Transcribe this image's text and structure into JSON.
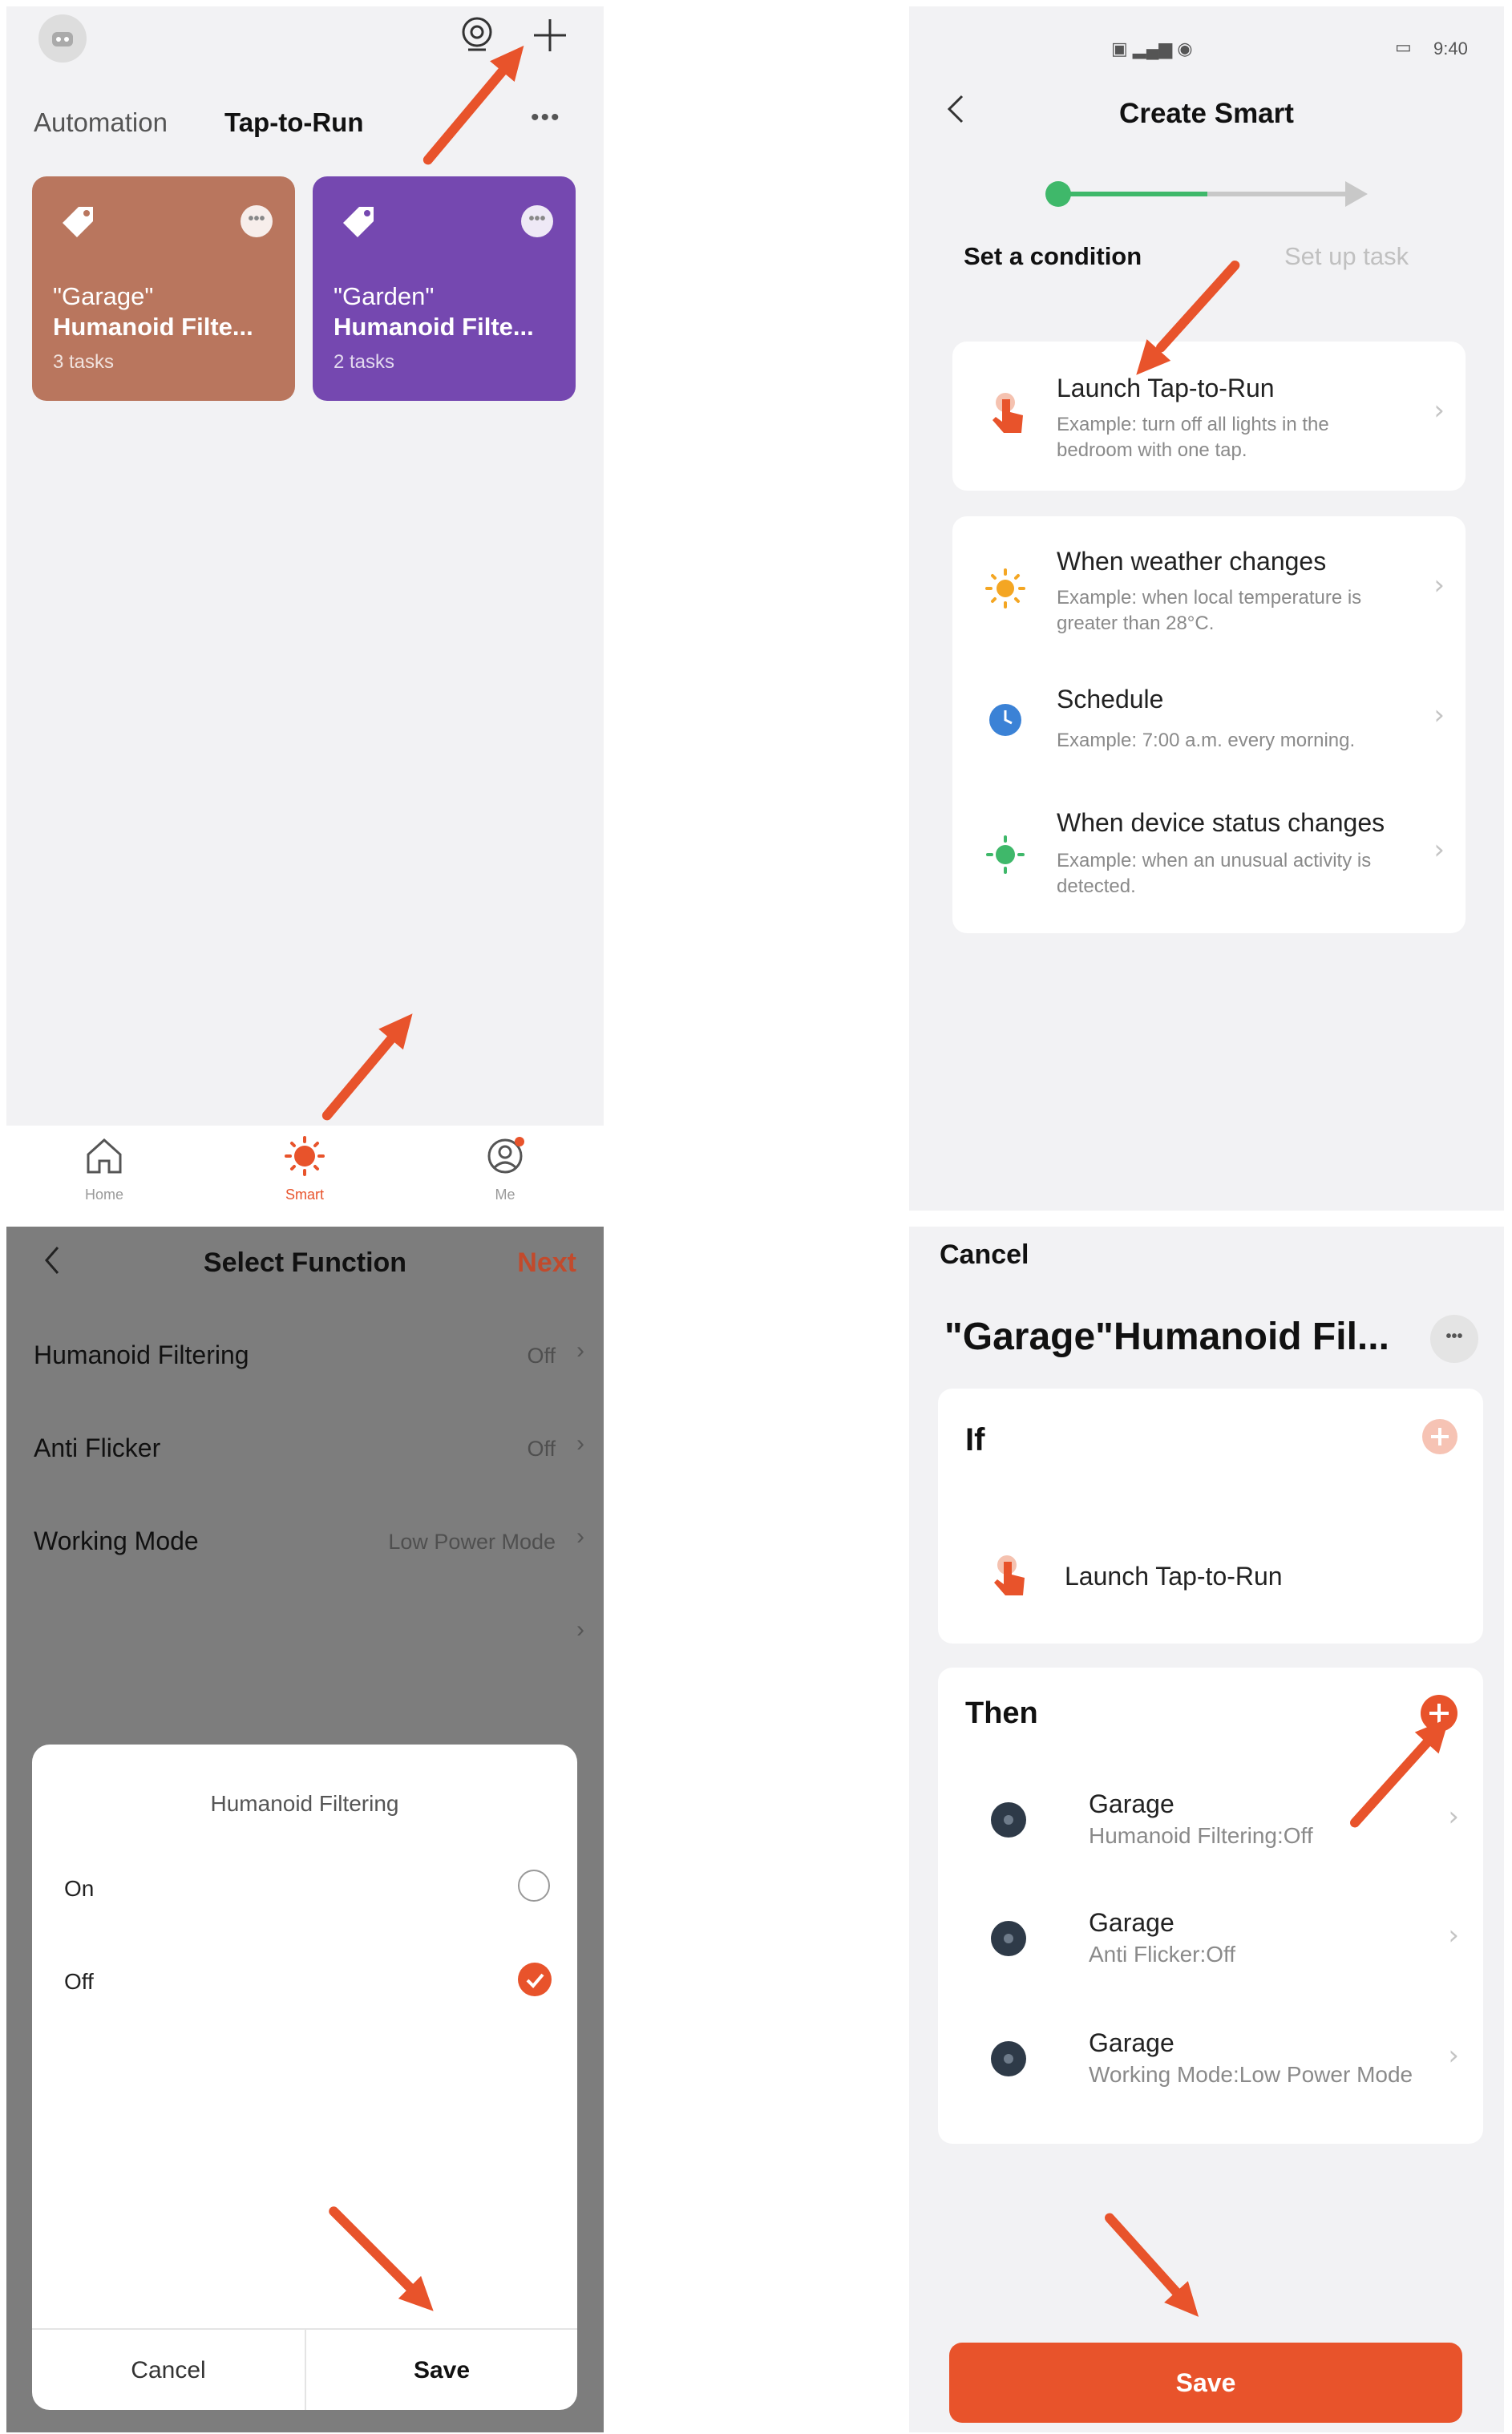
{
  "colors": {
    "accent": "#e8532b",
    "garage_tile": "#b9765e",
    "garden_tile": "#7548b0",
    "progress_green": "#3fb86a"
  },
  "panel1": {
    "tabs": [
      "Automation",
      "Tap-to-Run"
    ],
    "tiles": [
      {
        "title_line1": "\"Garage\"",
        "title_line2": "Humanoid Filte...",
        "subtitle": "3 tasks"
      },
      {
        "title_line1": "\"Garden\"",
        "title_line2": "Humanoid Filte...",
        "subtitle": "2 tasks"
      }
    ],
    "nav": [
      "Home",
      "Smart",
      "Me"
    ]
  },
  "panel2": {
    "status_time": "9:40",
    "title": "Create Smart",
    "steps": [
      "Set a condition",
      "Set up task"
    ],
    "options": [
      {
        "title": "Launch Tap-to-Run",
        "example": "Example: turn off all lights in the bedroom with one tap.",
        "icon": "tap-icon"
      },
      {
        "title": "When weather changes",
        "example": "Example: when local temperature is greater than 28°C.",
        "icon": "sun-icon"
      },
      {
        "title": "Schedule",
        "example": "Example: 7:00 a.m. every morning.",
        "icon": "clock-icon"
      },
      {
        "title": "When device status changes",
        "example": "Example: when an unusual activity is detected.",
        "icon": "device-status-icon"
      }
    ]
  },
  "panel3": {
    "title": "Select Function",
    "next": "Next",
    "functions": [
      {
        "label": "Humanoid Filtering",
        "value": "Off"
      },
      {
        "label": "Anti Flicker",
        "value": "Off"
      },
      {
        "label": "Working Mode",
        "value": "Low Power Mode"
      }
    ],
    "dialog": {
      "title": "Humanoid Filtering",
      "options": [
        {
          "label": "On",
          "selected": false
        },
        {
          "label": "Off",
          "selected": true
        }
      ],
      "cancel": "Cancel",
      "save": "Save"
    }
  },
  "panel4": {
    "cancel": "Cancel",
    "title": "\"Garage\"Humanoid Fil...",
    "if_label": "If",
    "condition": "Launch Tap-to-Run",
    "then_label": "Then",
    "tasks": [
      {
        "device": "Garage",
        "detail": "Humanoid Filtering:Off"
      },
      {
        "device": "Garage",
        "detail": "Anti Flicker:Off"
      },
      {
        "device": "Garage",
        "detail": "Working Mode:Low Power Mode"
      }
    ],
    "save": "Save"
  }
}
